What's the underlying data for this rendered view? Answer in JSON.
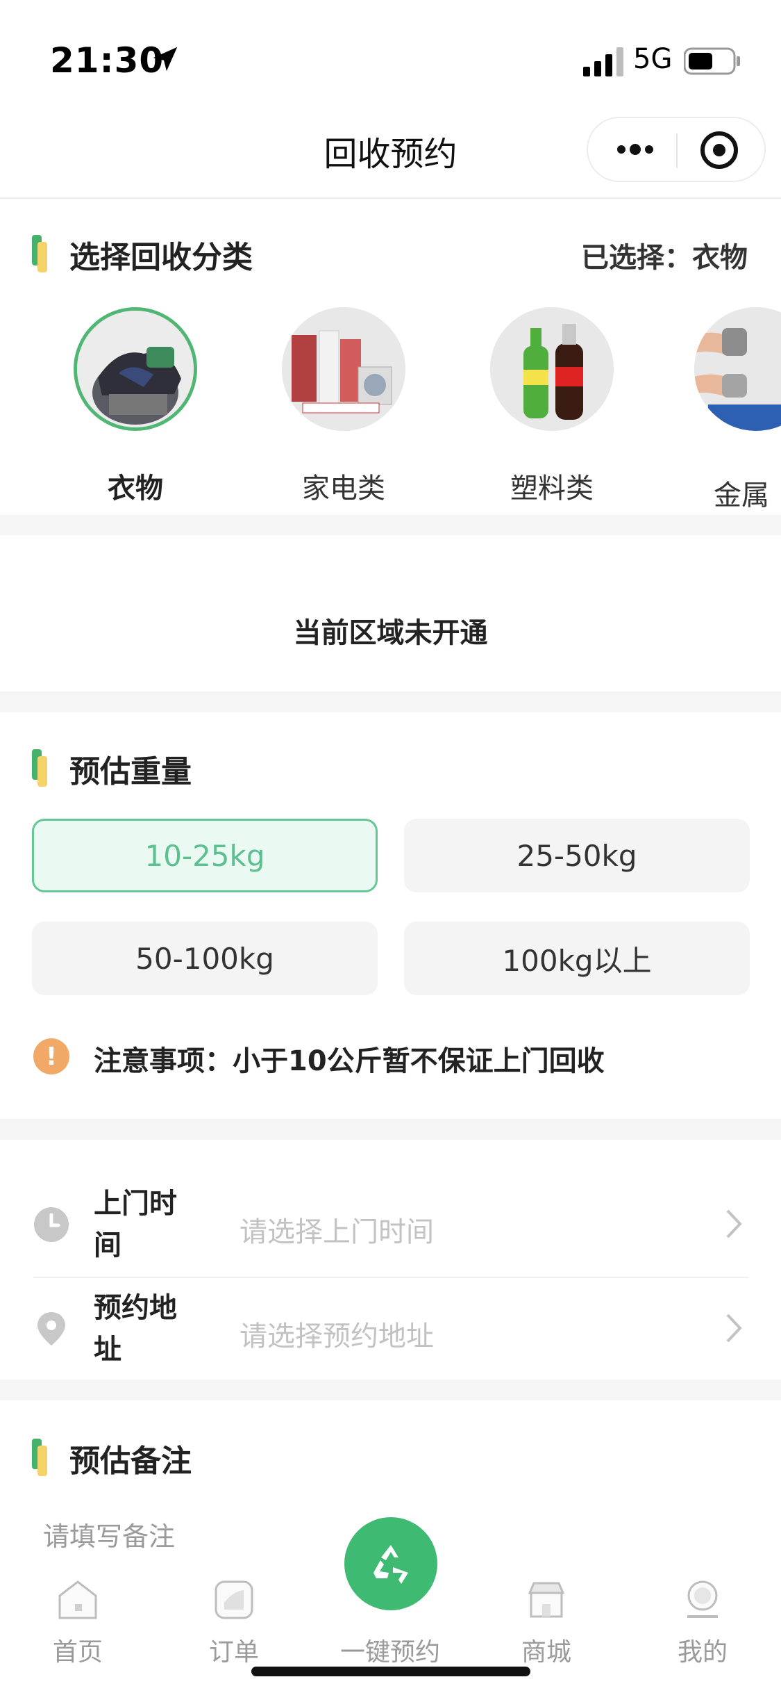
{
  "status_bar": {
    "time": "21:30",
    "network": "5G"
  },
  "nav": {
    "title": "回收预约"
  },
  "category_section": {
    "title": "选择回收分类",
    "selected_text": "已选择：衣物",
    "items": [
      {
        "label": "衣物",
        "selected": true
      },
      {
        "label": "家电类",
        "selected": false
      },
      {
        "label": "塑料类",
        "selected": false
      },
      {
        "label": "金属",
        "selected": false
      }
    ]
  },
  "region_notice": "当前区域未开通",
  "weight_section": {
    "title": "预估重量",
    "options": [
      "10-25kg",
      "25-50kg",
      "50-100kg",
      "100kg以上"
    ],
    "selected_index": 0,
    "notice": "注意事项：小于10公斤暂不保证上门回收"
  },
  "form": {
    "time_label": "上门时间",
    "time_placeholder": "请选择上门时间",
    "address_label": "预约地址",
    "address_placeholder": "请选择预约地址"
  },
  "remark_section": {
    "title": "预估备注",
    "placeholder": "请填写备注"
  },
  "tab_bar": {
    "items": [
      {
        "label": "首页",
        "icon": "home-icon"
      },
      {
        "label": "订单",
        "icon": "order-icon"
      },
      {
        "label": "一键预约",
        "icon": "recycle-icon"
      },
      {
        "label": "商城",
        "icon": "shop-icon"
      },
      {
        "label": "我的",
        "icon": "profile-icon"
      }
    ]
  },
  "colors": {
    "accent": "#45b26b",
    "warning": "#f2a967"
  }
}
